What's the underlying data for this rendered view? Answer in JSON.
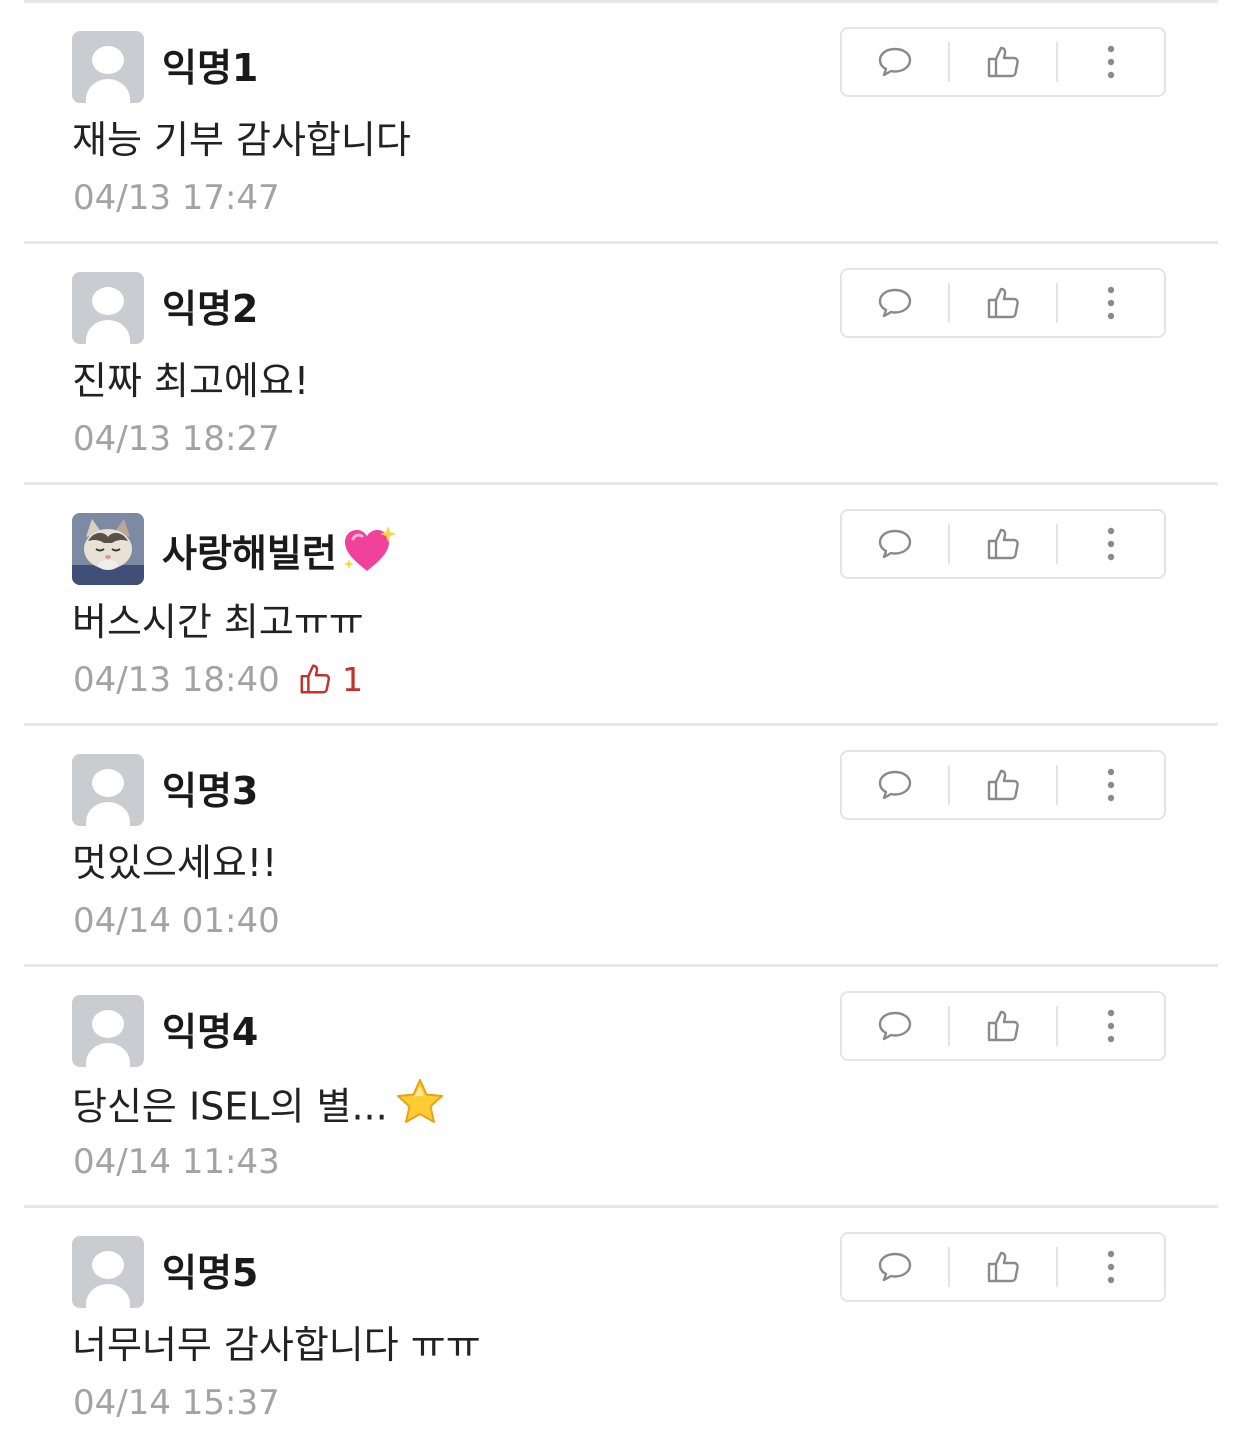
{
  "comments": [
    {
      "nickname": "익명1",
      "text": "재능 기부 감사합니다",
      "time": "04/13 17:47",
      "avatar": "default-avatar",
      "likes": null
    },
    {
      "nickname": "익명2",
      "text": "진짜 최고에요!",
      "time": "04/13 18:27",
      "avatar": "default-avatar",
      "likes": null
    },
    {
      "nickname": "사랑해빌런",
      "nickname_emoji": "sparkling-heart",
      "text": "버스시간 최고ㅠㅠ",
      "time": "04/13 18:40",
      "avatar": "cat-photo",
      "likes": "1"
    },
    {
      "nickname": "익명3",
      "text": "멋있으세요!!",
      "time": "04/14 01:40",
      "avatar": "default-avatar",
      "likes": null
    },
    {
      "nickname": "익명4",
      "text": "당신은 ISEL의 별...",
      "text_emoji": "star",
      "time": "04/14 11:43",
      "avatar": "default-avatar",
      "likes": null
    },
    {
      "nickname": "익명5",
      "text": "너무너무 감사합니다 ㅠㅠ",
      "time": "04/14 15:37",
      "avatar": "default-avatar",
      "likes": null
    }
  ],
  "action_icons": [
    "reply-icon",
    "like-icon",
    "more-icon"
  ],
  "colors": {
    "like_count": "#c4302b",
    "timestamp": "#a3a3a3",
    "divider": "#e8e8e8",
    "border": "#e4e4e4",
    "avatar_placeholder": "#c9ccd0"
  }
}
